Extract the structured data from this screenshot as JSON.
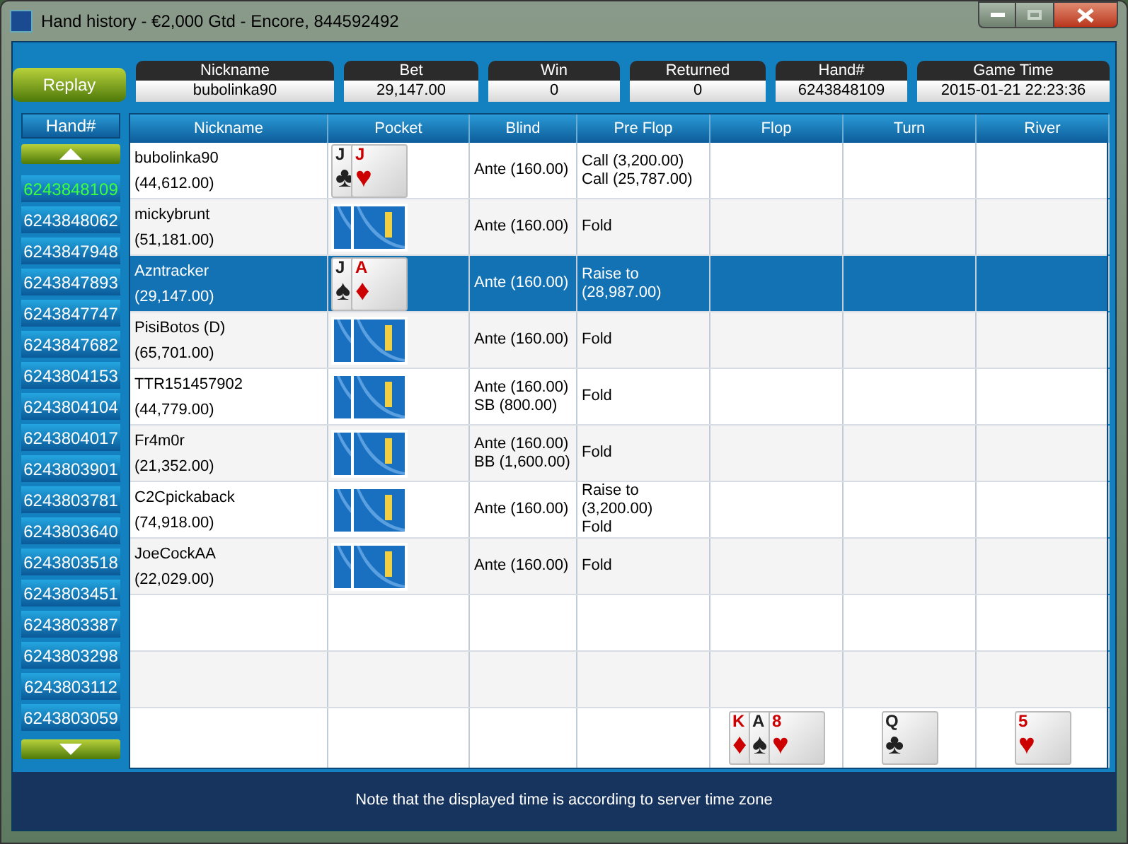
{
  "window": {
    "title": "Hand history - €2,000 Gtd - Encore, 844592492"
  },
  "replay_button": "Replay",
  "summary": [
    {
      "label": "Nickname",
      "value": "bubolinka90"
    },
    {
      "label": "Bet",
      "value": "29,147.00"
    },
    {
      "label": "Win",
      "value": "0"
    },
    {
      "label": "Returned",
      "value": "0"
    },
    {
      "label": "Hand#",
      "value": "6243848109"
    },
    {
      "label": "Game Time",
      "value": "2015-01-21 22:23:36"
    }
  ],
  "hand_list": {
    "header": "Hand#",
    "items": [
      {
        "label": "6243848109",
        "selected": true
      },
      {
        "label": "6243848062",
        "selected": false
      },
      {
        "label": "6243847948",
        "selected": false
      },
      {
        "label": "6243847893",
        "selected": false
      },
      {
        "label": "6243847747",
        "selected": false
      },
      {
        "label": "6243847682",
        "selected": false
      },
      {
        "label": "6243804153",
        "selected": false
      },
      {
        "label": "6243804104",
        "selected": false
      },
      {
        "label": "6243804017",
        "selected": false
      },
      {
        "label": "6243803901",
        "selected": false
      },
      {
        "label": "6243803781",
        "selected": false
      },
      {
        "label": "6243803640",
        "selected": false
      },
      {
        "label": "6243803518",
        "selected": false
      },
      {
        "label": "6243803451",
        "selected": false
      },
      {
        "label": "6243803387",
        "selected": false
      },
      {
        "label": "6243803298",
        "selected": false
      },
      {
        "label": "6243803112",
        "selected": false
      },
      {
        "label": "6243803059",
        "selected": false
      }
    ]
  },
  "table": {
    "columns": [
      "Nickname",
      "Pocket",
      "Blind",
      "Pre Flop",
      "Flop",
      "Turn",
      "River"
    ],
    "rows": [
      {
        "nickname": "bubolinka90",
        "stack": "(44,612.00)",
        "pocket": [
          {
            "rank": "J",
            "suit": "♣",
            "color": "#222222"
          },
          {
            "rank": "J",
            "suit": "♥",
            "color": "#cc0000"
          }
        ],
        "blind": [
          "Ante (160.00)"
        ],
        "pre_flop": [
          "Call (3,200.00)",
          "Call (25,787.00)"
        ],
        "selected": false
      },
      {
        "nickname": "mickybrunt",
        "stack": "(51,181.00)",
        "pocket": [
          {
            "face_down": true
          },
          {
            "face_down": true
          }
        ],
        "blind": [
          "Ante (160.00)"
        ],
        "pre_flop": [
          "Fold"
        ],
        "selected": false
      },
      {
        "nickname": "Azntracker",
        "stack": "(29,147.00)",
        "pocket": [
          {
            "rank": "J",
            "suit": "♠",
            "color": "#222222"
          },
          {
            "rank": "A",
            "suit": "♦",
            "color": "#cc0000"
          }
        ],
        "blind": [
          "Ante (160.00)"
        ],
        "pre_flop": [
          "Raise to",
          "(28,987.00)"
        ],
        "selected": true
      },
      {
        "nickname": "PisiBotos (D)",
        "stack": "(65,701.00)",
        "pocket": [
          {
            "face_down": true
          },
          {
            "face_down": true
          }
        ],
        "blind": [
          "Ante (160.00)"
        ],
        "pre_flop": [
          "Fold"
        ],
        "selected": false
      },
      {
        "nickname": "TTR151457902",
        "stack": "(44,779.00)",
        "pocket": [
          {
            "face_down": true
          },
          {
            "face_down": true
          }
        ],
        "blind": [
          "Ante (160.00)",
          "SB (800.00)"
        ],
        "pre_flop": [
          "Fold"
        ],
        "selected": false
      },
      {
        "nickname": "Fr4m0r",
        "stack": "(21,352.00)",
        "pocket": [
          {
            "face_down": true
          },
          {
            "face_down": true
          }
        ],
        "blind": [
          "Ante (160.00)",
          "BB (1,600.00)"
        ],
        "pre_flop": [
          "Fold"
        ],
        "selected": false
      },
      {
        "nickname": "C2Cpickaback",
        "stack": "(74,918.00)",
        "pocket": [
          {
            "face_down": true
          },
          {
            "face_down": true
          }
        ],
        "blind": [
          "Ante (160.00)"
        ],
        "pre_flop": [
          "Raise to",
          "(3,200.00)",
          "Fold"
        ],
        "selected": false
      },
      {
        "nickname": "JoeCockAA",
        "stack": "(22,029.00)",
        "pocket": [
          {
            "face_down": true
          },
          {
            "face_down": true
          }
        ],
        "blind": [
          "Ante (160.00)"
        ],
        "pre_flop": [
          "Fold"
        ],
        "selected": false
      }
    ],
    "board": {
      "flop": [
        {
          "rank": "K",
          "suit": "♦",
          "color": "#cc0000"
        },
        {
          "rank": "A",
          "suit": "♠",
          "color": "#222222"
        },
        {
          "rank": "8",
          "suit": "♥",
          "color": "#cc0000"
        }
      ],
      "turn": [
        {
          "rank": "Q",
          "suit": "♣",
          "color": "#222222"
        }
      ],
      "river": [
        {
          "rank": "5",
          "suit": "♥",
          "color": "#cc0000"
        }
      ]
    }
  },
  "footer_note": "Note that the displayed time is according to server time zone"
}
